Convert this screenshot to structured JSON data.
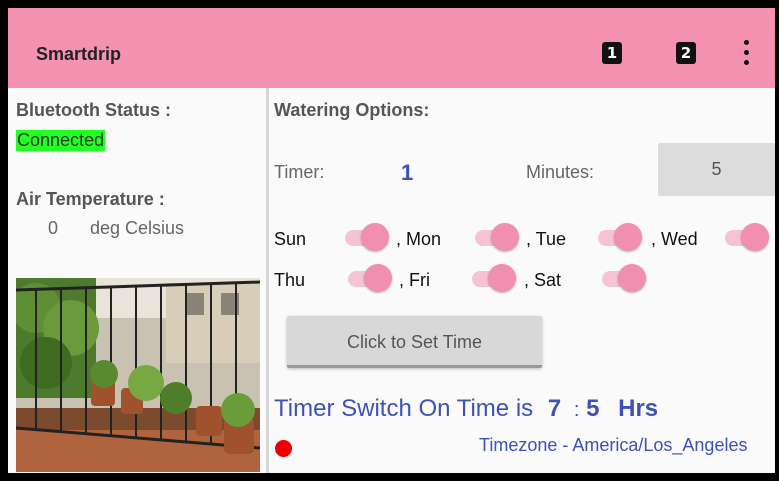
{
  "app": {
    "title": "Smartdrip"
  },
  "appbar": {
    "button1": "1",
    "button2": "2"
  },
  "left": {
    "bluetooth_label": "Bluetooth Status :",
    "bluetooth_value": "Connected",
    "air_label": "Air Temperature :",
    "air_value": "0",
    "air_unit": "deg Celsius"
  },
  "right": {
    "watering_label": "Watering Options:",
    "timer_label": "Timer:",
    "timer_value": "1",
    "minutes_label": "Minutes:",
    "minutes_value": "5",
    "days": {
      "sun": "Sun",
      "mon": ", Mon",
      "tue": ", Tue",
      "wed": ", Wed",
      "thu": "Thu",
      "fri": ", Fri",
      "sat": ", Sat"
    },
    "day_toggles_on": [
      true,
      true,
      true,
      true,
      true,
      true,
      true
    ],
    "set_time_button": "Click to Set Time",
    "switch_on_prefix": "Timer Switch On Time is",
    "switch_hour": "7",
    "switch_sep": ":",
    "switch_min": "5",
    "switch_unit": "Hrs",
    "timezone": "Timezone - America/Los_Angeles"
  },
  "colors": {
    "appbar": "#f592b2",
    "accent": "#3f51b5",
    "status": "#22ff22",
    "indicator": "#ee0000"
  },
  "icons": {
    "overflow": "more-vert-icon"
  }
}
